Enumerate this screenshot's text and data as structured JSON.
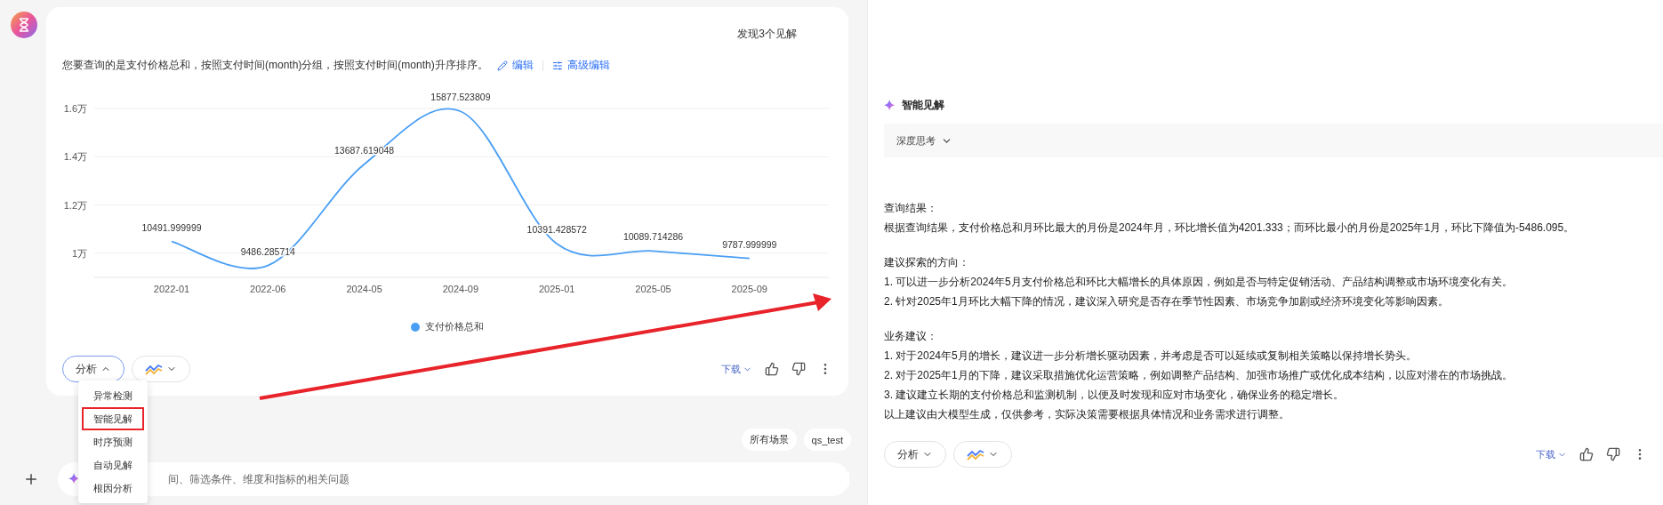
{
  "assistant": {
    "insight_count": "发现3个见解",
    "query_summary": "您要查询的是支付价格总和，按照支付时间(month)分组，按照支付时间(month)升序排序。",
    "edit_link": "编辑",
    "advanced_edit_link": "高级编辑",
    "chart": {
      "chart_data": {
        "type": "line",
        "categories": [
          "2022-01",
          "2022-06",
          "2024-05",
          "2024-09",
          "2025-01",
          "2025-05",
          "2025-09"
        ],
        "series": [
          {
            "name": "支付价格总和",
            "color": "#4a9ff5",
            "values": [
              1.049,
              0.949,
              1.369,
              1.588,
              1.039,
              1.009,
              0.979
            ]
          }
        ],
        "grid": true,
        "ylim": [
          0.9,
          1.6
        ],
        "yticks": [
          {
            "value": 1,
            "label": "1万"
          },
          {
            "value": 1.2,
            "label": "1.2万"
          },
          {
            "value": 1.4,
            "label": "1.4万"
          },
          {
            "value": 1.6,
            "label": "1.6万"
          }
        ],
        "value_labels": [
          "10491.999999",
          "9486.285714",
          "13687.619048",
          "15877.523809",
          "10391.428572",
          "10089.714286",
          "9787.999999"
        ]
      }
    },
    "toolbar": {
      "analysis_button": "分析",
      "analysis_expanded": true,
      "download": "下载"
    }
  },
  "analysis_menu": [
    {
      "label": "异常检测",
      "selected": false
    },
    {
      "label": "智能见解",
      "selected": true
    },
    {
      "label": "时序预测",
      "selected": false
    },
    {
      "label": "自动见解",
      "selected": false
    },
    {
      "label": "根因分析",
      "selected": false
    }
  ],
  "tags": [
    "所有场景",
    "qs_test"
  ],
  "input": {
    "placeholder": "间、筛选条件、维度和指标的相关问题"
  },
  "insight_panel": {
    "title": "智能见解",
    "thinking": {
      "label": "深度思考",
      "expanded": false
    },
    "sections": [
      {
        "heading": "查询结果：",
        "lines": [
          "根据查询结果，支付价格总和月环比最大的月份是2024年月，环比增长值为4201.333；而环比最小的月份是2025年1月，环比下降值为-5486.095。"
        ]
      },
      {
        "heading": "建议探索的方向：",
        "lines": [
          "1. 可以进一步分析2024年5月支付价格总和环比大幅增长的具体原因，例如是否与特定促销活动、产品结构调整或市场环境变化有关。",
          "2. 针对2025年1月环比大幅下降的情况，建议深入研究是否存在季节性因素、市场竞争加剧或经济环境变化等影响因素。"
        ]
      },
      {
        "heading": "业务建议：",
        "lines": [
          "1. 对于2024年5月的增长，建议进一步分析增长驱动因素，并考虑是否可以延续或复制相关策略以保持增长势头。",
          "2. 对于2025年1月的下降，建议采取措施优化运营策略，例如调整产品结构、加强市场推广或优化成本结构，以应对潜在的市场挑战。",
          "3. 建议建立长期的支付价格总和监测机制，以便及时发现和应对市场变化，确保业务的稳定增长。",
          "以上建议由大模型生成，仅供参考，实际决策需要根据具体情况和业务需求进行调整。"
        ]
      }
    ],
    "toolbar": {
      "analysis_button": "分析",
      "analysis_expanded": false,
      "download": "下载"
    }
  }
}
